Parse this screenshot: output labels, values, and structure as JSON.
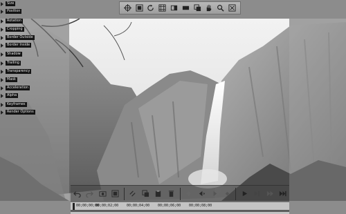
{
  "toolbar": {
    "icons": [
      "crosshair-icon",
      "crop-icon",
      "rotate-icon",
      "grid-icon",
      "panel-icon",
      "rectangle-icon",
      "layers-icon",
      "hand-icon",
      "zoom-icon",
      "fit-icon"
    ]
  },
  "options": {
    "items": [
      {
        "label": "Size"
      },
      {
        "label": "Position"
      },
      {
        "label": "Rotation"
      },
      {
        "label": "Cropping"
      },
      {
        "label": "Border Outside"
      },
      {
        "label": "Border Inside"
      },
      {
        "label": "Shadow"
      },
      {
        "label": "Trailing"
      },
      {
        "label": "Transparency"
      },
      {
        "label": "Mask"
      },
      {
        "label": "Acceleration"
      },
      {
        "label": "Alpha"
      },
      {
        "label": "Keyframes"
      },
      {
        "label": "Render Options"
      }
    ]
  },
  "controls": {
    "icons": [
      "undo-icon",
      "redo-icon",
      "snapshot-icon",
      "frame-icon",
      "link-icon",
      "copy-icon",
      "paste-icon",
      "delete-icon",
      "keyframe-add-icon",
      "keyframe-prev-icon",
      "keyframe-next-icon",
      "keyframe-remove-icon",
      "play-icon",
      "step-forward-icon",
      "fast-forward-icon",
      "end-icon"
    ]
  },
  "timeline": {
    "timecodes": [
      "00;00;00;00",
      "00;00;02;00",
      "00;00;04;00",
      "00;00;06;00",
      "00;00;08;00"
    ]
  }
}
